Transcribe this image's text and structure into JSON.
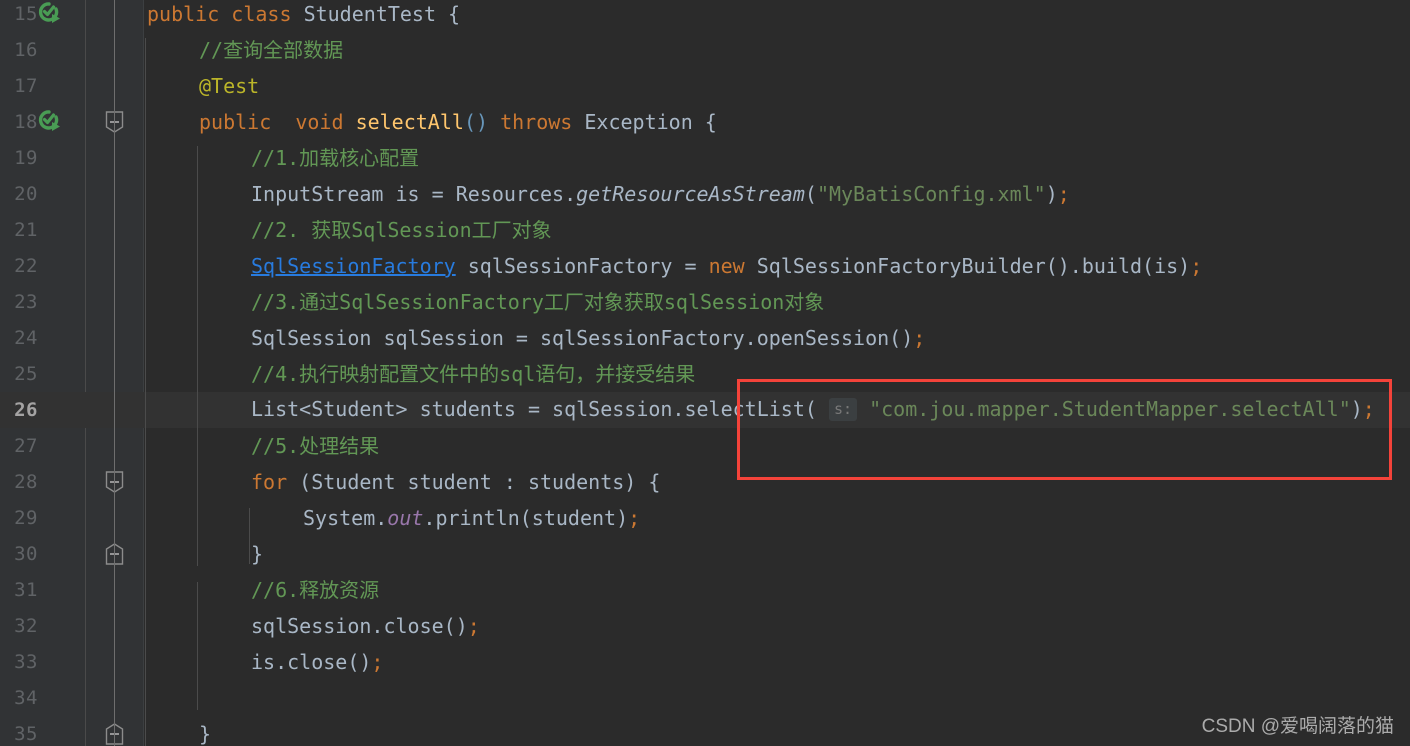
{
  "editor": {
    "theme_name": "Darcula",
    "background": "#2b2b2b",
    "gutter_background": "#313335",
    "current_line_background": "#323232",
    "current_line": 26,
    "first_visible_line": 15,
    "last_visible_line": 35,
    "lines": [
      {
        "number": "15",
        "indent": 0,
        "has_run_icon": true,
        "fold": null,
        "text": "public class StudentTest {"
      },
      {
        "number": "16",
        "indent": 1,
        "has_run_icon": false,
        "fold": null,
        "text": "//查询全部数据"
      },
      {
        "number": "17",
        "indent": 1,
        "has_run_icon": false,
        "fold": null,
        "text": "@Test"
      },
      {
        "number": "18",
        "indent": 1,
        "has_run_icon": true,
        "fold": "collapse",
        "text": "public  void selectAll() throws Exception {"
      },
      {
        "number": "19",
        "indent": 2,
        "has_run_icon": false,
        "fold": null,
        "text": "//1.加载核心配置"
      },
      {
        "number": "20",
        "indent": 2,
        "has_run_icon": false,
        "fold": null,
        "text": "InputStream is = Resources.getResourceAsStream(\"MyBatisConfig.xml\");"
      },
      {
        "number": "21",
        "indent": 2,
        "has_run_icon": false,
        "fold": null,
        "text": "//2. 获取SqlSession工厂对象"
      },
      {
        "number": "22",
        "indent": 2,
        "has_run_icon": false,
        "fold": null,
        "text": "SqlSessionFactory sqlSessionFactory = new SqlSessionFactoryBuilder().build(is);"
      },
      {
        "number": "23",
        "indent": 2,
        "has_run_icon": false,
        "fold": null,
        "text": "//3.通过SqlSessionFactory工厂对象获取sqlSession对象"
      },
      {
        "number": "24",
        "indent": 2,
        "has_run_icon": false,
        "fold": null,
        "text": "SqlSession sqlSession = sqlSessionFactory.openSession();"
      },
      {
        "number": "25",
        "indent": 2,
        "has_run_icon": false,
        "fold": null,
        "text": "//4.执行映射配置文件中的sql语句，并接受结果"
      },
      {
        "number": "26",
        "indent": 2,
        "has_run_icon": false,
        "fold": null,
        "text": "List<Student> students = sqlSession.selectList( s: \"com.jou.mapper.StudentMapper.selectAll\");"
      },
      {
        "number": "27",
        "indent": 2,
        "has_run_icon": false,
        "fold": null,
        "text": "//5.处理结果"
      },
      {
        "number": "28",
        "indent": 2,
        "has_run_icon": false,
        "fold": "collapse",
        "text": "for (Student student : students) {"
      },
      {
        "number": "29",
        "indent": 3,
        "has_run_icon": false,
        "fold": null,
        "text": "System.out.println(student);"
      },
      {
        "number": "30",
        "indent": 2,
        "has_run_icon": false,
        "fold": "expand",
        "text": "}"
      },
      {
        "number": "31",
        "indent": 2,
        "has_run_icon": false,
        "fold": null,
        "text": "//6.释放资源"
      },
      {
        "number": "32",
        "indent": 2,
        "has_run_icon": false,
        "fold": null,
        "text": "sqlSession.close();"
      },
      {
        "number": "33",
        "indent": 2,
        "has_run_icon": false,
        "fold": null,
        "text": "is.close();"
      },
      {
        "number": "34",
        "indent": 2,
        "has_run_icon": false,
        "fold": null,
        "text": ""
      },
      {
        "number": "35",
        "indent": 1,
        "has_run_icon": false,
        "fold": "expand",
        "text": "}"
      }
    ],
    "tokens": {
      "l15": [
        {
          "t": "public",
          "c": "kw"
        },
        {
          "t": " ",
          "c": "pun"
        },
        {
          "t": "class",
          "c": "kw"
        },
        {
          "t": " ",
          "c": "pun"
        },
        {
          "t": "StudentTest",
          "c": "cls"
        },
        {
          "t": " {",
          "c": "pun"
        }
      ],
      "l16": [
        {
          "t": "//查询全部数据",
          "c": "cmt"
        }
      ],
      "l17": [
        {
          "t": "@Test",
          "c": "ann"
        }
      ],
      "l18": [
        {
          "t": "public",
          "c": "kw"
        },
        {
          "t": "  ",
          "c": "pun"
        },
        {
          "t": "void",
          "c": "kw"
        },
        {
          "t": " ",
          "c": "pun"
        },
        {
          "t": "selectAll",
          "c": "mth"
        },
        {
          "t": "()",
          "c": "num"
        },
        {
          "t": " ",
          "c": "pun"
        },
        {
          "t": "throws",
          "c": "kw"
        },
        {
          "t": " ",
          "c": "pun"
        },
        {
          "t": "Exception",
          "c": "cls"
        },
        {
          "t": " {",
          "c": "pun"
        }
      ],
      "l19": [
        {
          "t": "//1.加载核心配置",
          "c": "cmt"
        }
      ],
      "l20": [
        {
          "t": "InputStream is = Resources.",
          "c": "idn"
        },
        {
          "t": "getResourceAsStream",
          "c": "statm"
        },
        {
          "t": "(",
          "c": "pun"
        },
        {
          "t": "\"MyBatisConfig.xml\"",
          "c": "str"
        },
        {
          "t": ")",
          "c": "pun"
        },
        {
          "t": ";",
          "c": "semi"
        }
      ],
      "l21": [
        {
          "t": "//2. 获取SqlSession工厂对象",
          "c": "cmt"
        }
      ],
      "l22": [
        {
          "t": "SqlSessionFactory",
          "c": "lnk"
        },
        {
          "t": " sqlSessionFactory = ",
          "c": "idn"
        },
        {
          "t": "new",
          "c": "kw"
        },
        {
          "t": " SqlSessionFactoryBuilder().build(is)",
          "c": "idn"
        },
        {
          "t": ";",
          "c": "semi"
        }
      ],
      "l23": [
        {
          "t": "//3.通过SqlSessionFactory工厂对象获取sqlSession对象",
          "c": "cmt"
        }
      ],
      "l24": [
        {
          "t": "SqlSession sqlSession = sqlSessionFactory.openSession()",
          "c": "idn"
        },
        {
          "t": ";",
          "c": "semi"
        }
      ],
      "l25": [
        {
          "t": "//4.执行映射配置文件中的sql语句，并接受结果",
          "c": "cmt"
        }
      ],
      "l26": [
        {
          "t": "List<Student> students = sqlSession.selectList(",
          "c": "idn"
        },
        {
          "t": " ",
          "c": "pun"
        },
        {
          "t": "s:",
          "c": "hint"
        },
        {
          "t": " ",
          "c": "pun"
        },
        {
          "t": "\"com.jou.mapper.StudentMapper.selectAll\"",
          "c": "str"
        },
        {
          "t": ")",
          "c": "pun"
        },
        {
          "t": ";",
          "c": "semi"
        }
      ],
      "l27": [
        {
          "t": "//5.处理结果",
          "c": "cmt"
        }
      ],
      "l28": [
        {
          "t": "for",
          "c": "kw"
        },
        {
          "t": " (Student student : students) {",
          "c": "idn"
        }
      ],
      "l29": [
        {
          "t": "System.",
          "c": "idn"
        },
        {
          "t": "out",
          "c": "stat"
        },
        {
          "t": ".println(student)",
          "c": "idn"
        },
        {
          "t": ";",
          "c": "semi"
        }
      ],
      "l30": [
        {
          "t": "}",
          "c": "pun"
        }
      ],
      "l31": [
        {
          "t": "//6.释放资源",
          "c": "cmt"
        }
      ],
      "l32": [
        {
          "t": "sqlSession.close()",
          "c": "idn"
        },
        {
          "t": ";",
          "c": "semi"
        }
      ],
      "l33": [
        {
          "t": "is.close()",
          "c": "idn"
        },
        {
          "t": ";",
          "c": "semi"
        }
      ],
      "l34": [],
      "l35": [
        {
          "t": "}",
          "c": "pun"
        }
      ]
    }
  },
  "annotation": {
    "type": "rectangle-highlight",
    "color": "#f4433a",
    "target_line": 26,
    "target_text": "s: \"com.jou.mapper.StudentMapper.selectAll\");"
  },
  "gutter_icons": {
    "run_test_icon_color": "#499c54",
    "run_test_tooltip": "Run test",
    "fold_collapse_symbol": "−",
    "fold_expand_symbol": "−"
  },
  "watermark": {
    "text": "CSDN @爱喝阔落的猫"
  }
}
